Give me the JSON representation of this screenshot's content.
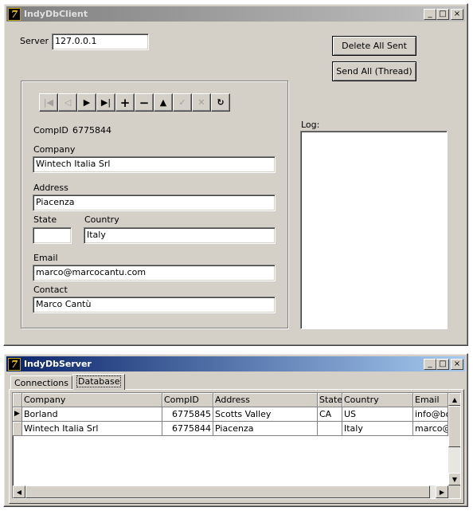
{
  "client": {
    "title": "IndyDbClient",
    "server_label": "Server",
    "server_value": "127.0.0.1",
    "delete_all_sent": "Delete All Sent",
    "send_all_thread": "Send All (Thread)",
    "log_label": "Log:",
    "compid_label": "CompID",
    "compid_value": "6775844",
    "company_label": "Company",
    "company_value": "Wintech Italia Srl",
    "address_label": "Address",
    "address_value": "Piacenza",
    "state_label": "State",
    "state_value": "",
    "country_label": "Country",
    "country_value": "Italy",
    "email_label": "Email",
    "email_value": "marco@marcocantu.com",
    "contact_label": "Contact",
    "contact_value": "Marco Cantù",
    "navigator": [
      "first-icon",
      "prior-icon",
      "next-icon",
      "last-icon",
      "insert-icon",
      "delete-icon",
      "edit-icon",
      "post-icon",
      "cancel-icon",
      "refresh-icon"
    ]
  },
  "server": {
    "title": "IndyDbServer",
    "tabs": [
      "Connections",
      "Database"
    ],
    "selected_tab": "Database",
    "columns": [
      "Company",
      "CompID",
      "Address",
      "State",
      "Country",
      "Email"
    ],
    "rows": [
      {
        "company": "Borland",
        "compid": "6775845",
        "address": "Scotts Valley",
        "state": "CA",
        "country": "US",
        "email": "info@bo"
      },
      {
        "company": "Wintech Italia Srl",
        "compid": "6775844",
        "address": "Piacenza",
        "state": "",
        "country": "Italy",
        "email": "marco@"
      }
    ]
  },
  "window_buttons": {
    "minimize": "_",
    "maximize": "□",
    "close": "×"
  }
}
